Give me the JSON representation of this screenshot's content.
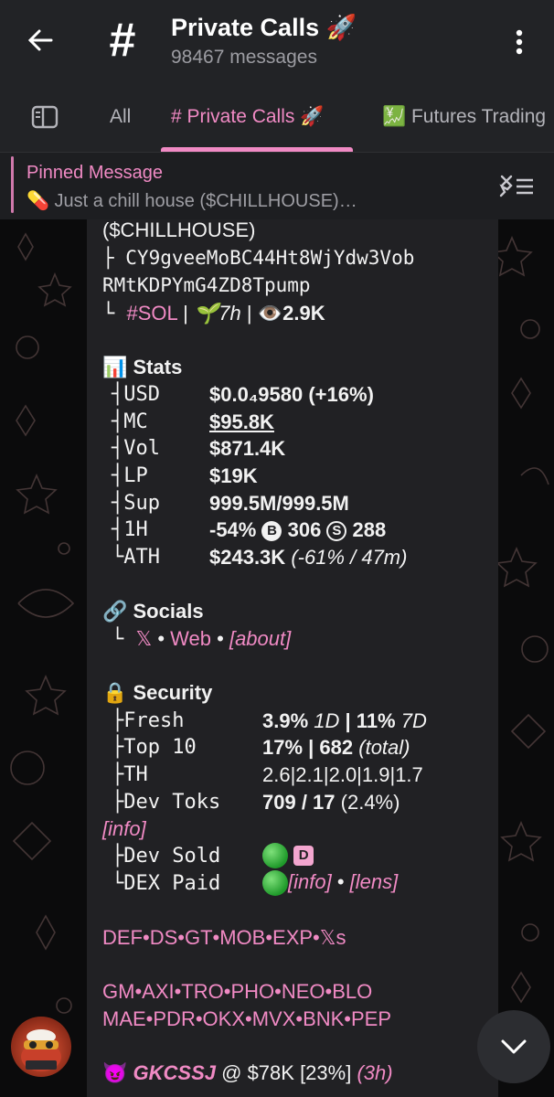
{
  "header": {
    "title": "Private Calls 🚀",
    "subtitle": "98467 messages",
    "back_icon": "arrow-left-icon",
    "more_icon": "kebab-menu-icon",
    "channel_icon": "#"
  },
  "tabs": [
    {
      "label": "All"
    },
    {
      "label": "# Private Calls 🚀"
    },
    {
      "label": "💹 Futures Trading"
    }
  ],
  "pinned": {
    "title": "Pinned Message",
    "text": "💊 Just a chill house ($CHILLHOUSE)…"
  },
  "message": {
    "ticker_line": "($CHILLHOUSE)",
    "ca_line1": "├ CY9gveeMoBC44Ht8WjYdw3Vob",
    "ca_line2": "RMtKDPYmG4ZD8Tpump",
    "meta_prefix": "└ ",
    "chain": "#SOL",
    "sep1": " | ",
    "age": "🌱7h",
    "sep2": " | ",
    "views": "👁️2.9K",
    "stats": {
      "heading": "📊 Stats",
      "rows": [
        {
          "label": "┤USD",
          "value": "$0.0₄9580 (+16%)"
        },
        {
          "label": "┤MC",
          "value": "$95.8K"
        },
        {
          "label": "┤Vol",
          "value": "$871.4K"
        },
        {
          "label": "┤LP",
          "value": "$19K"
        },
        {
          "label": "┤Sup",
          "value": "999.5M/999.5M"
        },
        {
          "label": "┤1H",
          "value_a": "-54% ",
          "badge_b": "B",
          "value_b": " 306 ",
          "badge_s": "S",
          "value_c": " 288"
        },
        {
          "label": "└ATH",
          "value": "$243.3K",
          "value_i": "(-61% / 47m)"
        }
      ]
    },
    "socials": {
      "heading": "🔗 Socials",
      "prefix": "└ ",
      "x": "𝕏",
      "dot1": " • ",
      "web": "Web",
      "dot2": " • ",
      "about": "[about]"
    },
    "security": {
      "heading": "🔒 Security",
      "fresh_label": "├Fresh",
      "fresh_val": "3.9%",
      "fresh_1d": "1D",
      "fresh_sep": " | ",
      "fresh_val2": "11%",
      "fresh_7d": "7D",
      "top10_label": "├Top 10",
      "top10_val": "17% | 682",
      "top10_total": "(total)",
      "th_label": "├TH",
      "th_val": "2.6|2.1|2.0|1.9|1.7",
      "devtoks_label": "├Dev Toks",
      "devtoks_val": "709 / 17",
      "devtoks_pct": "(2.4%)",
      "info": "[info]",
      "devsold_label": "├Dev Sold",
      "devsold_badge": "D",
      "dexpaid_label": "└DEX Paid",
      "dexpaid_info": "[info]",
      "dexpaid_dot": " • ",
      "dexpaid_lens": "[lens]"
    },
    "links1": "DEF•DS•GT•MOB•EXP•𝕏s",
    "links2a": "GM•AXI•TRO•PHO•NEO•BLO",
    "links2b": "MAE•PDR•OKX•MVX•BNK•PEP",
    "caller": {
      "emoji": "😈",
      "name": "GKCSSJ",
      "rest": " @ $78K [23%] ",
      "time": "(3h)"
    }
  },
  "colors": {
    "accent": "#f08ac4",
    "topbar": "#222326",
    "bubble": "#212124"
  }
}
